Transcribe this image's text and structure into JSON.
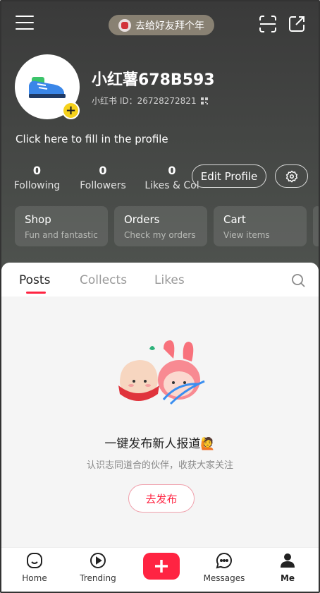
{
  "header": {
    "promo_pill": "去给好友拜个年",
    "username": "小红薯678B593",
    "user_id_label": "小红书 ID：26728272821",
    "bio_prompt": "Click here to fill in the profile"
  },
  "stats": [
    {
      "value": "0",
      "label": "Following"
    },
    {
      "value": "0",
      "label": "Followers"
    },
    {
      "value": "0",
      "label": "Likes & Col"
    }
  ],
  "actions": {
    "edit_profile": "Edit Profile"
  },
  "cards": [
    {
      "title": "Shop",
      "subtitle": "Fun and fantastic"
    },
    {
      "title": "Orders",
      "subtitle": "Check my orders"
    },
    {
      "title": "Cart",
      "subtitle": "View items"
    }
  ],
  "tabs": [
    {
      "label": "Posts",
      "active": true
    },
    {
      "label": "Collects",
      "active": false
    },
    {
      "label": "Likes",
      "active": false
    }
  ],
  "empty_state": {
    "title": "一键发布新人报道🙋",
    "subtitle": "认识志同道合的伙伴，收获大家关注",
    "button": "去发布"
  },
  "bottom_nav": {
    "home": "Home",
    "trending": "Trending",
    "messages": "Messages",
    "me": "Me"
  },
  "colors": {
    "accent": "#ff2442",
    "avatar_badge": "#f6d21c"
  }
}
